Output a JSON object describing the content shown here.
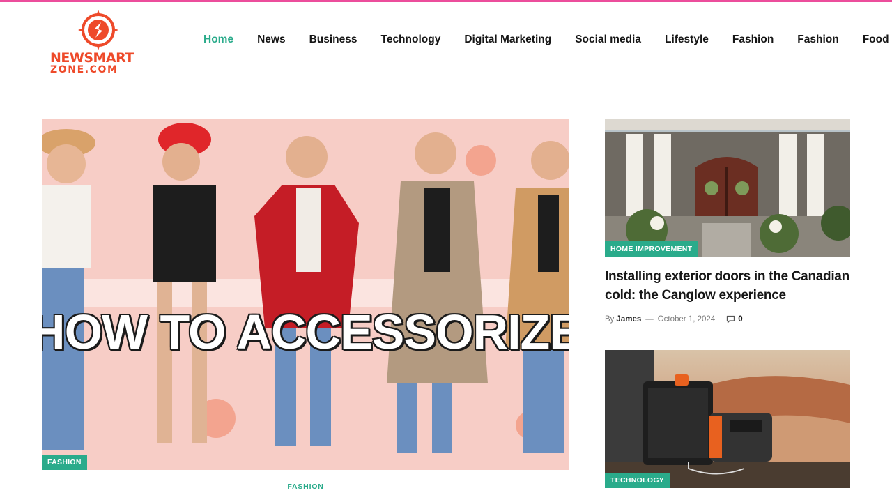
{
  "colors": {
    "accent": "#2aab8b",
    "top_bar": "#ec4d9c",
    "logo": "#ee4a2a",
    "text": "#161616"
  },
  "logo": {
    "line1": "NEWSMART",
    "line2": "ZONE.COM",
    "icon": "logo-emblem"
  },
  "nav": {
    "items": [
      {
        "label": "Home",
        "active": true
      },
      {
        "label": "News"
      },
      {
        "label": "Business"
      },
      {
        "label": "Technology"
      },
      {
        "label": "Digital Marketing"
      },
      {
        "label": "Social media"
      },
      {
        "label": "Lifestyle"
      },
      {
        "label": "Fashion"
      },
      {
        "label": "Fashion"
      },
      {
        "label": "Food"
      }
    ]
  },
  "feature": {
    "image_caption": "HOW TO ACCESSORIZE",
    "badge": "FASHION",
    "category": "FASHION"
  },
  "side_posts": [
    {
      "badge": "HOME IMPROVEMENT",
      "title": "Installing exterior doors in the Canadian cold: the Canglow experience",
      "by_label": "By",
      "author": "James",
      "separator": "—",
      "date": "October 1, 2024",
      "comments": "0",
      "comment_icon": "comment-icon"
    },
    {
      "badge": "TECHNOLOGY"
    }
  ]
}
